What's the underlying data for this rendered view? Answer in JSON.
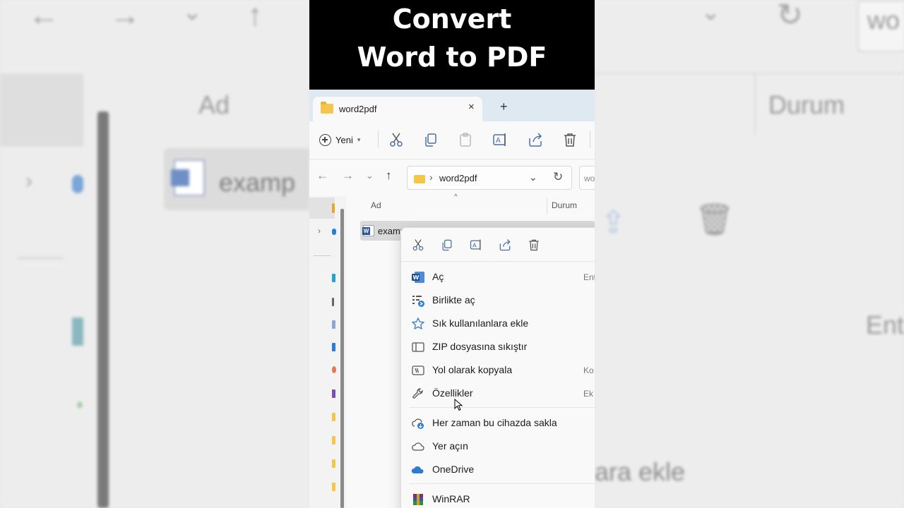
{
  "background": {
    "left_header": "Ad",
    "left_file": "examp",
    "right_header": "Durum",
    "right_search": "wo",
    "right_shortcut": "Ent",
    "right_menu_fragment": "ara ekle"
  },
  "banner": {
    "line1": "Convert",
    "line2": "Word to PDF"
  },
  "tab": {
    "label": "word2pdf",
    "close": "×",
    "new": "+"
  },
  "toolbar": {
    "new_label": "Yeni",
    "icons": [
      "cut-icon",
      "copy-icon",
      "paste-icon",
      "rename-icon",
      "share-icon",
      "delete-icon"
    ]
  },
  "address": {
    "crumb_sep": "›",
    "path": "word2pdf",
    "search_text": "wo"
  },
  "file_list": {
    "col_name": "Ad",
    "col_status": "Durum",
    "file_name": "examp"
  },
  "context_menu": {
    "quick_icons": [
      "cut-icon",
      "copy-icon",
      "rename-icon",
      "share-icon",
      "delete-icon"
    ],
    "items": [
      {
        "label": "Aç",
        "shortcut": "Ent",
        "icon": "word-icon"
      },
      {
        "label": "Birlikte aç",
        "shortcut": "",
        "icon": "open-with-icon"
      },
      {
        "label": "Sık kullanılanlara ekle",
        "shortcut": "",
        "icon": "star-icon"
      },
      {
        "label": "ZIP dosyasına sıkıştır",
        "shortcut": "",
        "icon": "zip-icon"
      },
      {
        "label": "Yol olarak kopyala",
        "shortcut": "Ko",
        "icon": "copy-path-icon"
      },
      {
        "label": "Özellikler",
        "shortcut": "Ek",
        "icon": "wrench-icon"
      },
      {
        "label": "Her zaman bu cihazda sakla",
        "shortcut": "",
        "icon": "cloud-keep-icon"
      },
      {
        "label": "Yer açın",
        "shortcut": "",
        "icon": "cloud-outline-icon"
      },
      {
        "label": "OneDrive",
        "shortcut": "",
        "icon": "onedrive-icon"
      },
      {
        "label": "WinRAR",
        "shortcut": "",
        "icon": "winrar-icon"
      }
    ]
  },
  "colors": {
    "accent_blue": "#2b7cd3",
    "folder_yellow": "#f4c64a",
    "word_blue": "#2b579a"
  }
}
